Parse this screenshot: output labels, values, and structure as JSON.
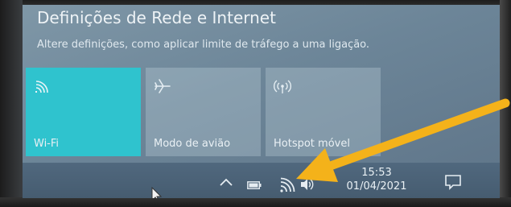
{
  "panel": {
    "title": "Definições de Rede e Internet",
    "subtitle": "Altere definições, como aplicar limite de tráfego a uma ligação."
  },
  "quick_actions": [
    {
      "label": "Wi-Fi",
      "icon": "wifi-icon",
      "active": true
    },
    {
      "label": "Modo de avião",
      "icon": "airplane-icon",
      "active": false
    },
    {
      "label": "Hotspot móvel",
      "icon": "hotspot-icon",
      "active": false
    }
  ],
  "taskbar": {
    "time": "15:53",
    "date": "01/04/2021",
    "tray_icons": [
      "chevron-up-icon",
      "battery-icon",
      "wifi-icon",
      "volume-icon",
      "action-center-icon"
    ]
  },
  "colors": {
    "active_tile": "#2fc3ce",
    "annotation_arrow": "#f4b21a"
  }
}
